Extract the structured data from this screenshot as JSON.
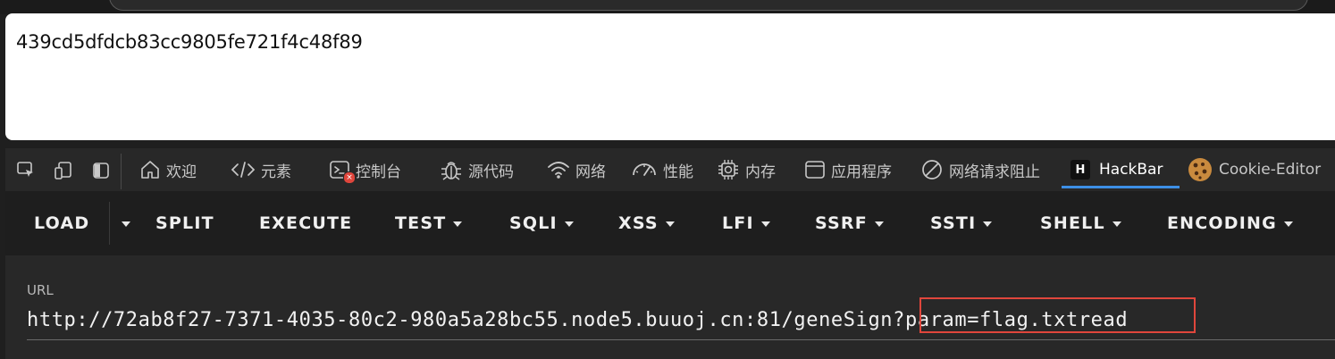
{
  "page": {
    "content_text": "439cd5dfdcb83cc9805fe721f4c48f89"
  },
  "devtools": {
    "tool_icons": [
      "inspect-element-icon",
      "device-toolbar-icon",
      "sidebar-toggle-icon"
    ],
    "tabs": [
      {
        "label": "欢迎",
        "icon": "home-icon"
      },
      {
        "label": "元素",
        "icon": "code-icon"
      },
      {
        "label": "控制台",
        "icon": "console-icon"
      },
      {
        "label": "源代码",
        "icon": "bug-icon"
      },
      {
        "label": "网络",
        "icon": "wifi-icon"
      },
      {
        "label": "性能",
        "icon": "performance-icon"
      },
      {
        "label": "内存",
        "icon": "memory-chip-icon"
      },
      {
        "label": "应用程序",
        "icon": "application-icon"
      },
      {
        "label": "网络请求阻止",
        "icon": "block-icon"
      },
      {
        "label": "HackBar",
        "icon": "hackbar-logo-icon",
        "active": true
      },
      {
        "label": "Cookie-Editor",
        "icon": "cookie-icon"
      }
    ],
    "active_tab_color": "#3d8fe6"
  },
  "hackbar": {
    "buttons": {
      "load": "LOAD",
      "split": "SPLIT",
      "execute": "EXECUTE",
      "test": "TEST",
      "sqli": "SQLI",
      "xss": "XSS",
      "lfi": "LFI",
      "ssrf": "SSRF",
      "ssti": "SSTI",
      "shell": "SHELL",
      "encoding": "ENCODING"
    },
    "url_label": "URL",
    "url_value": "http://72ab8f27-7371-4035-80c2-980a5a28bc55.node5.buuoj.cn:81/geneSign?param=flag.txtread",
    "highlight_color": "#e0463c"
  }
}
